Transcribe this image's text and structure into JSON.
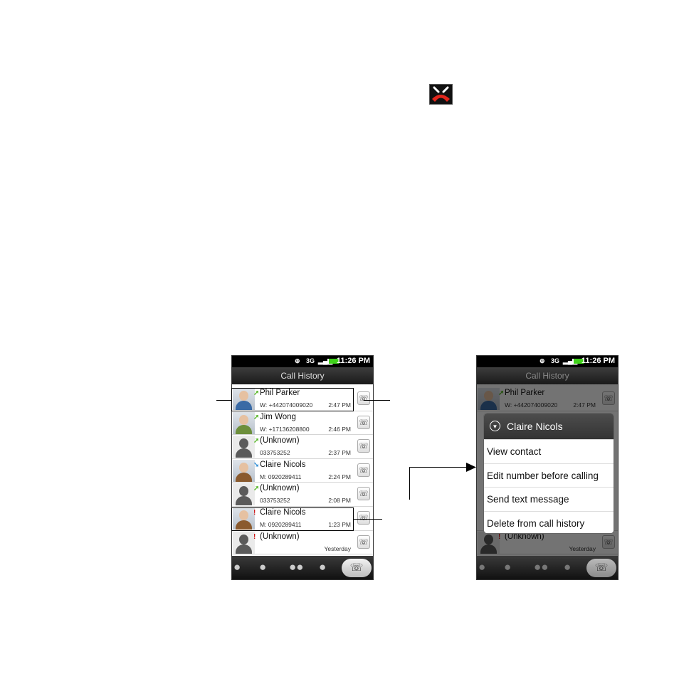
{
  "icons": {
    "end_call": "end-call-icon",
    "signal": "signal-icon",
    "battery": "battery-icon",
    "gps": "gps-icon",
    "call_button": "call-icon"
  },
  "status_bar": {
    "network": "3G",
    "time": "11:26 PM"
  },
  "screen_title": "Call History",
  "call_history": [
    {
      "name": "Phil Parker",
      "number": "W: +442074009020",
      "time": "2:47 PM",
      "type": "outgoing",
      "photo": "person"
    },
    {
      "name": "Jim Wong",
      "number": "W: +17136208800",
      "time": "2:46 PM",
      "type": "outgoing",
      "photo": "person"
    },
    {
      "name": "(Unknown)",
      "number": "033753252",
      "time": "2:37 PM",
      "type": "outgoing",
      "photo": "unknown"
    },
    {
      "name": "Claire Nicols",
      "number": "M: 0920289411",
      "time": "2:24 PM",
      "type": "incoming",
      "photo": "person"
    },
    {
      "name": "(Unknown)",
      "number": "033753252",
      "time": "2:08 PM",
      "type": "outgoing",
      "photo": "unknown"
    },
    {
      "name": "Claire Nicols",
      "number": "M: 0920289411",
      "time": "1:23 PM",
      "type": "missed",
      "photo": "person"
    },
    {
      "name": "(Unknown)",
      "number": "",
      "time": "Yesterday",
      "type": "missed",
      "photo": "unknown"
    }
  ],
  "context_menu": {
    "title": "Claire Nicols",
    "items": [
      "View contact",
      "Edit number before calling",
      "Send text message",
      "Delete from call history"
    ]
  },
  "tabs": [
    "contacts",
    "favorites",
    "groups",
    "online-directory",
    "call-history"
  ],
  "colors": {
    "outgoing": "#5cb82e",
    "incoming": "#3a93d8",
    "missed": "#d01818",
    "end_call_red": "#e1261c"
  }
}
